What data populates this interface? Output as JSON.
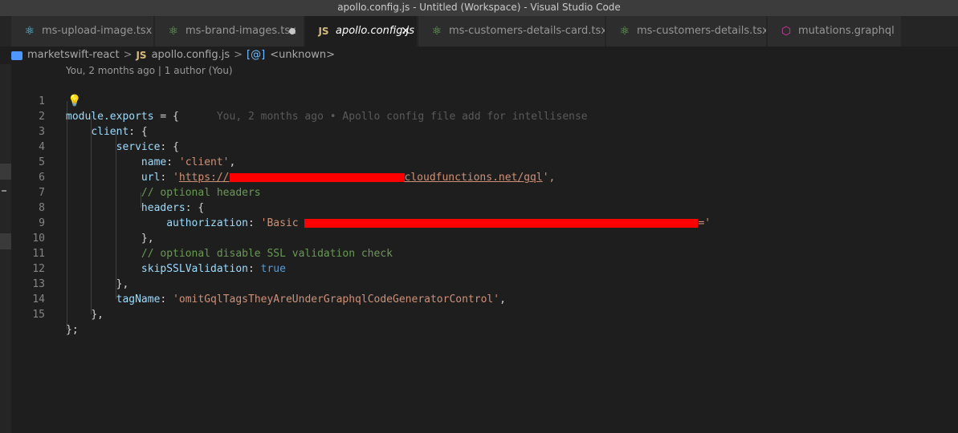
{
  "window": {
    "title": "apollo.config.js - Untitled (Workspace) - Visual Studio Code"
  },
  "tabs": [
    {
      "label": "ms-upload-image.tsx",
      "icon": "react-icon"
    },
    {
      "label": "ms-brand-images.tsx",
      "icon": "test-icon",
      "modified": true
    },
    {
      "label": "apollo.config.js",
      "icon": "js-icon",
      "badge": "JS",
      "active": true,
      "close": "✕"
    },
    {
      "label": "ms-customers-details-card.tsx",
      "icon": "test-icon"
    },
    {
      "label": "ms-customers-details.tsx",
      "icon": "test-icon"
    },
    {
      "label": "mutations.graphql",
      "icon": "graphql-icon"
    }
  ],
  "breadcrumb": {
    "folder": "marketswift-react",
    "sep": ">",
    "file_badge": "JS",
    "file": "apollo.config.js",
    "symbol_badge": "[@]",
    "symbol": "<unknown>"
  },
  "editor": {
    "codelens": "You, 2 months ago | 1 author (You)",
    "blame": "You, 2 months ago • Apollo config file add for intellisense",
    "line_numbers": [
      "1",
      "2",
      "3",
      "4",
      "5",
      "6",
      "7",
      "8",
      "9",
      "10",
      "11",
      "12",
      "13",
      "14",
      "15"
    ],
    "code": {
      "l1_key": "module.exports",
      "l1_rest": " = {",
      "l2_key": "client",
      "l2_rest": ": {",
      "l3_key": "service",
      "l3_rest": ": {",
      "l4_key": "name",
      "l4_sep": ": ",
      "l4_val": "'client'",
      "l4_end": ",",
      "l5_key": "url",
      "l5_sep": ": ",
      "l5_q": "'",
      "l5_url_start": "https://",
      "l5_url_end": "cloudfunctions.net/gql",
      "l5_end": "',",
      "l6_comment": "// optional headers",
      "l7_key": "headers",
      "l7_rest": ": {",
      "l8_key": "authorization",
      "l8_sep": ": ",
      "l8_val_start": "'Basic ",
      "l8_val_end": "='",
      "l9": "},",
      "l10_comment": "// optional disable SSL validation check",
      "l11_key": "skipSSLValidation",
      "l11_sep": ": ",
      "l11_val": "true",
      "l12": "},",
      "l13_key": "tagName",
      "l13_sep": ": ",
      "l13_val": "'omitGqlTagsTheyAreUnderGraphqlCodeGeneratorControl'",
      "l13_end": ",",
      "l14": "},",
      "l15": "};"
    }
  },
  "colors": {
    "keyword": "#569cd6",
    "property": "#9cdcfe",
    "string": "#ce9178",
    "comment": "#6a9955",
    "redaction": "#ff0000"
  }
}
